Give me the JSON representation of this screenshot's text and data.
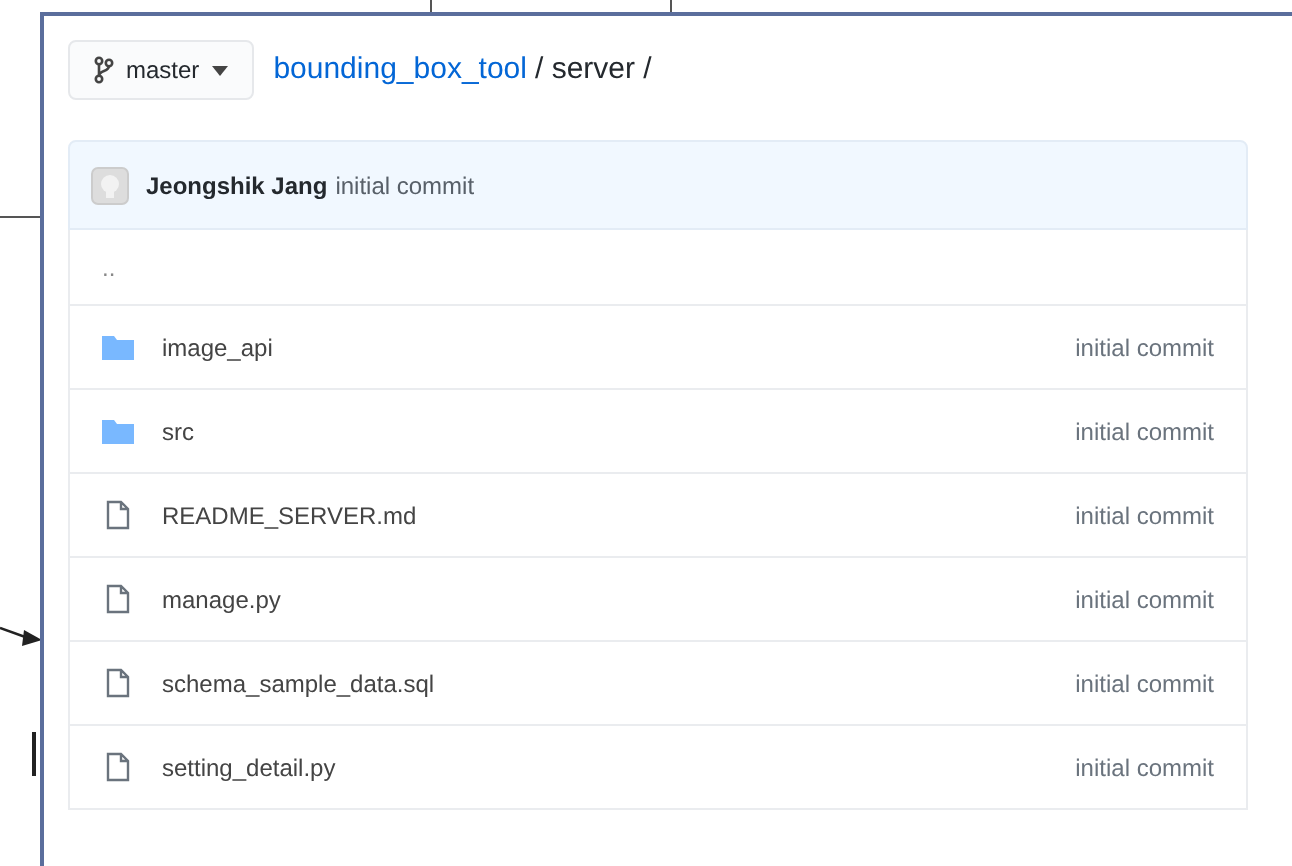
{
  "branch": {
    "label": "master"
  },
  "breadcrumb": {
    "repo": "bounding_box_tool",
    "path": "/ server /"
  },
  "latest_commit": {
    "author": "Jeongshik Jang",
    "message": "initial commit"
  },
  "parent_dir": "..",
  "files": [
    {
      "kind": "folder",
      "name": "image_api",
      "commit": "initial commit"
    },
    {
      "kind": "folder",
      "name": "src",
      "commit": "initial commit"
    },
    {
      "kind": "file",
      "name": "README_SERVER.md",
      "commit": "initial commit"
    },
    {
      "kind": "file",
      "name": "manage.py",
      "commit": "initial commit"
    },
    {
      "kind": "file",
      "name": "schema_sample_data.sql",
      "commit": "initial commit"
    },
    {
      "kind": "file",
      "name": "setting_detail.py",
      "commit": "initial commit"
    }
  ]
}
